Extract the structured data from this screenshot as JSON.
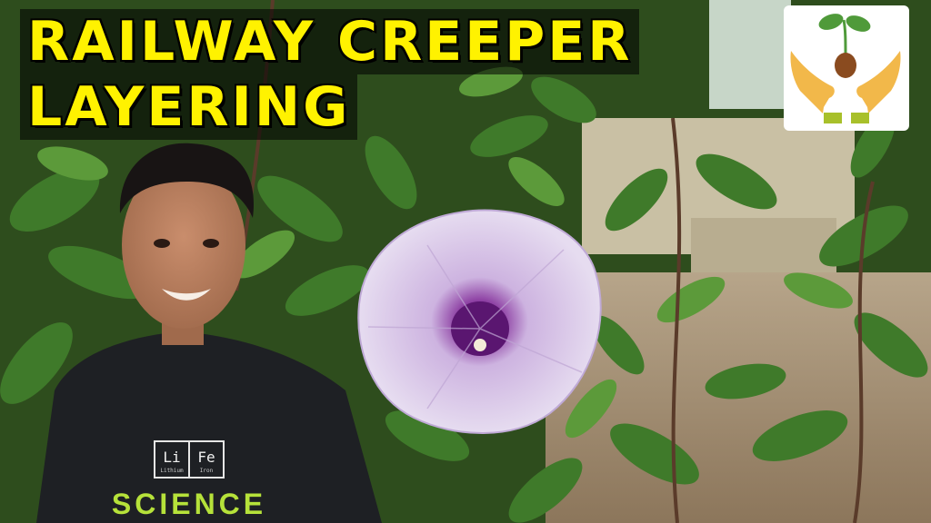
{
  "title": {
    "line1": "RAILWAY CREEPER",
    "line2": "LAYERING"
  },
  "shirt": {
    "element1_symbol": "Li",
    "element2_symbol": "Fe",
    "element1_name": "Lithium",
    "element2_name": "Iron",
    "word": "SCIENCE"
  },
  "colors": {
    "title_text": "#fff200",
    "flower_petal": "#d9c9e8",
    "flower_center": "#7a2a8c",
    "foliage": "#3f7a2a"
  }
}
